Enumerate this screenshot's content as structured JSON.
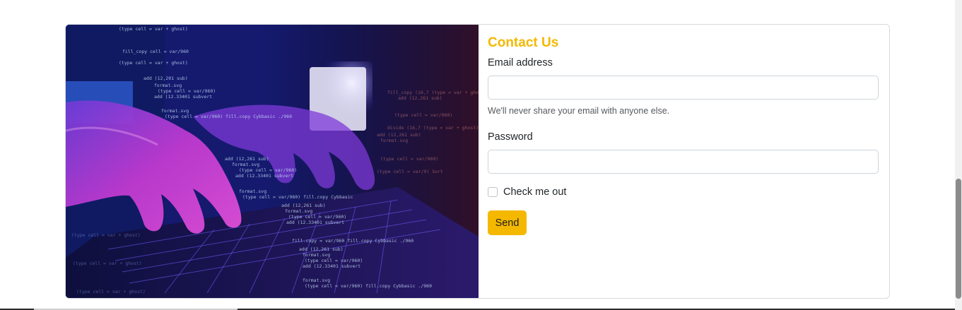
{
  "form": {
    "title": "Contact Us",
    "email_label": "Email address",
    "email_value": "",
    "email_help": "We'll never share your email with anyone else.",
    "password_label": "Password",
    "password_value": "",
    "checkbox_label": "Check me out",
    "checkbox_checked": false,
    "submit_label": "Send"
  },
  "image": {
    "alt": "Hands typing on a laptop keyboard with code overlay",
    "code_lines": [
      "format.svg",
      "add (12,201 sub)",
      "type cell = var/960",
      "add (12.3340) subvert",
      "format.svg",
      "fill.copy Cybbasic ./960",
      "add (12,261 sub)",
      "(type cell = var/96)",
      "(12.33401 subvert"
    ]
  },
  "colors": {
    "accent": "#f5b800",
    "border": "#d8dadd"
  }
}
